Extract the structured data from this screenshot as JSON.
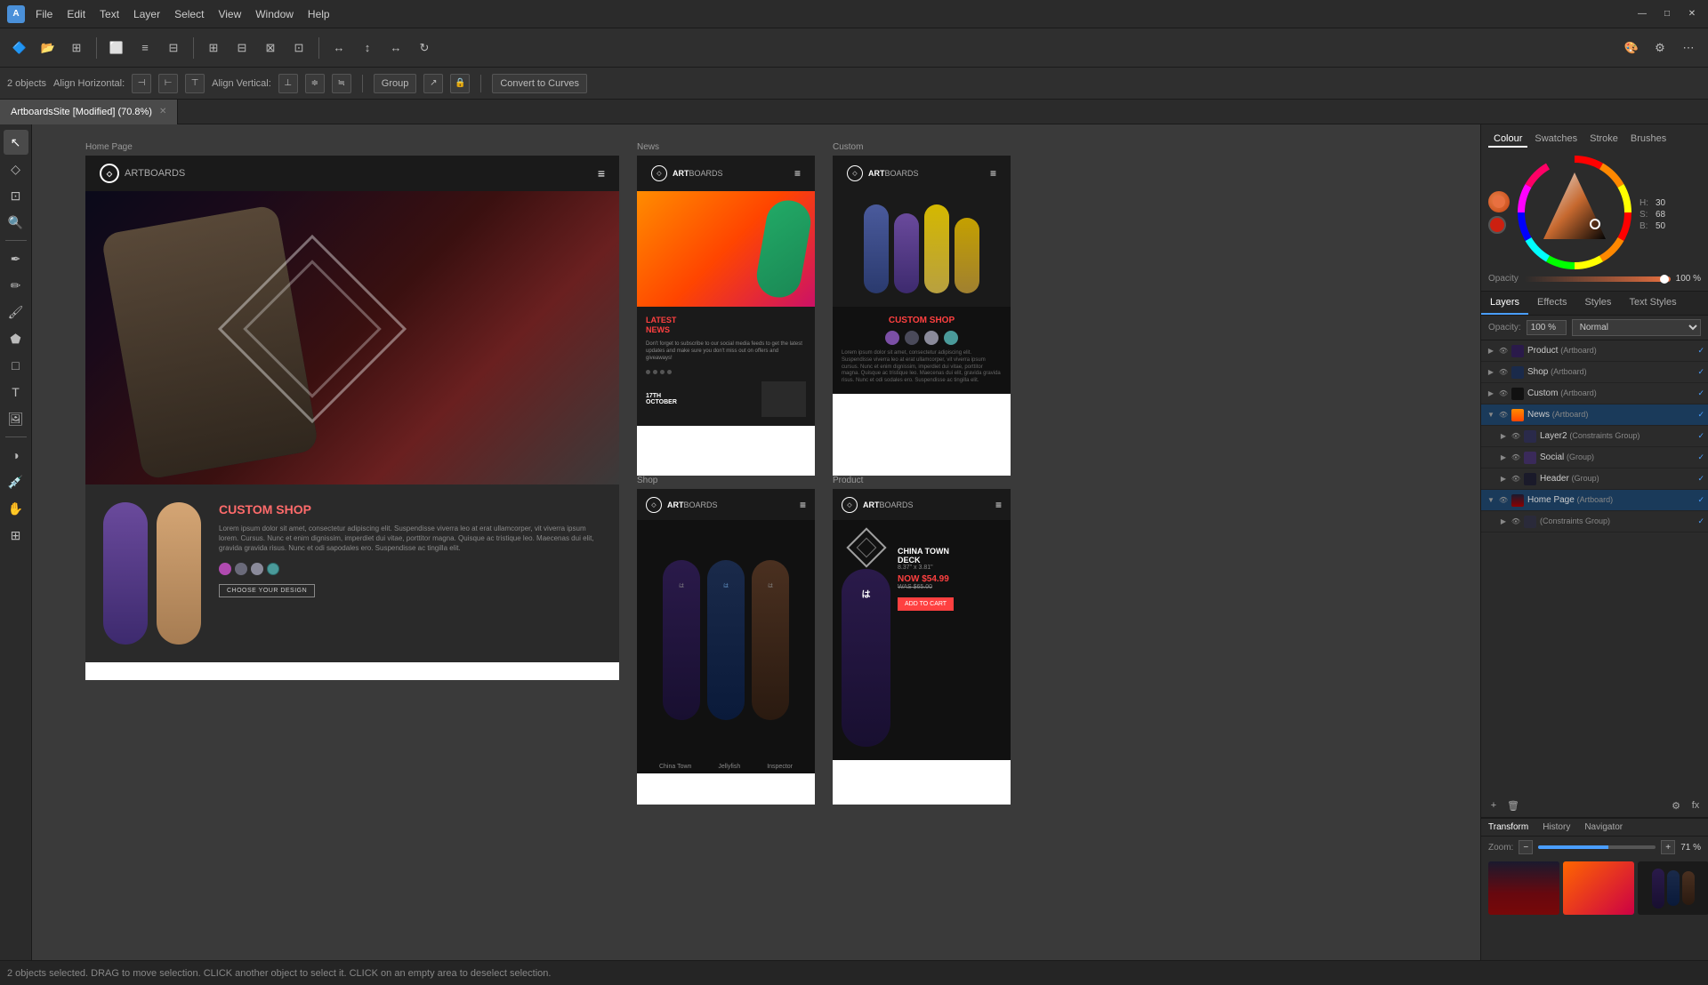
{
  "app": {
    "title": "ArtboardsSite [Modified] (70.8%)",
    "menu": [
      "File",
      "Edit",
      "Text",
      "Layer",
      "Select",
      "View",
      "Window",
      "Help"
    ]
  },
  "toolbar": {
    "items": [
      "new",
      "open",
      "save",
      "export",
      "grid",
      "grid2",
      "grid3",
      "transform",
      "transform2",
      "transform3",
      "transform4",
      "align",
      "align2",
      "align3",
      "align4",
      "align5",
      "snap",
      "snap2",
      "flip",
      "flip2",
      "rotate",
      "more"
    ]
  },
  "options": {
    "objects_selected": "2 objects",
    "align_horizontal": "Align Horizontal:",
    "align_vertical": "Align Vertical:",
    "group_label": "Group",
    "convert_label": "Convert to Curves"
  },
  "artboards": {
    "home_page": {
      "label": "Home Page",
      "hero_overlay": "ARTBOARDS",
      "custom_shop_title": "CUSTOM SHOP",
      "shop_desc": "Lorem ipsum dolor sit amet, consectetur adipiscing elit. Suspendisse viverra leo at erat ullamcorper, vit viverra ipsum lorem. Cursus. Nunc et enim dignissim, imperdiet dui vitae, porttitor magna. Quisque ac tristique leo. Maecenas dui elit, gravida gravida risus. Nunc et odi sapodales ero. Suspendisse ac tingilla elit.",
      "choose_btn": "CHOOSE YOUR DESIGN",
      "logo_text": "ART",
      "logo_subtext": "BOARDS"
    },
    "news": {
      "label": "News",
      "logo_text": "ART",
      "logo_subtext": "BOARDS",
      "section_title": "LATEST\nNEWS",
      "news_text": "Don't forget to subscribe to our social media feeds to get the latest updates and make sure you don't miss out on offers and giveaways!",
      "date": "17TH\nOCTOBER"
    },
    "custom": {
      "label": "Custom",
      "logo_text": "ART",
      "logo_subtext": "BOARDS",
      "shop_title": "CUSTOM SHOP",
      "lorem_text": "Lorem ipsum dolor sit amet, consectetur adipiscing elit. Suspendisse viverra leo at erat ullamcorper, vit viverra ipsum cursus. Nunc et enim dignissim, imperdiet dui vitae, porttitor magna. Quisque ac tristique leo. Maecenas dui elit, gravida gravida risus. Nunc et odi sodales ero. Suspendisse ac tingilla elit."
    },
    "shop": {
      "label": "Shop",
      "logo_text": "ART",
      "logo_subtext": "BOARDS"
    },
    "product": {
      "label": "Product",
      "logo_text": "ART",
      "logo_subtext": "BOARDS",
      "deck_name": "CHINA TOWN\nDECK",
      "dimensions": "8.37\" x 3.81\"",
      "price_now": "NOW $54.99",
      "price_was": "WAS $65.00"
    }
  },
  "right_panel": {
    "tabs": [
      "Colour",
      "Swatches",
      "Stroke",
      "Brushes"
    ],
    "active_tab": "Colour",
    "hsb": {
      "h": "30",
      "s": "68",
      "b": "50"
    },
    "opacity_label": "Opacity",
    "opacity_value": "100 %"
  },
  "layers_panel": {
    "tabs": [
      "Layers",
      "Effects",
      "Styles",
      "Text Styles"
    ],
    "active_tab": "Layers",
    "blend_mode": "Normal",
    "opacity": "100 %",
    "items": [
      {
        "name": "Product",
        "type": "Artboard",
        "indent": 0,
        "expanded": false,
        "visible": true,
        "locked": false
      },
      {
        "name": "Shop",
        "type": "Artboard",
        "indent": 0,
        "expanded": false,
        "visible": true,
        "locked": false
      },
      {
        "name": "Custom",
        "type": "Artboard",
        "indent": 0,
        "expanded": false,
        "visible": true,
        "locked": false
      },
      {
        "name": "News",
        "type": "Artboard",
        "indent": 0,
        "expanded": true,
        "visible": true,
        "locked": false
      },
      {
        "name": "Layer2",
        "type": "Constraints Group",
        "indent": 1,
        "expanded": false,
        "visible": true,
        "locked": false
      },
      {
        "name": "Social",
        "type": "Group",
        "indent": 1,
        "expanded": false,
        "visible": true,
        "locked": false
      },
      {
        "name": "Header",
        "type": "Group",
        "indent": 1,
        "expanded": false,
        "visible": true,
        "locked": false
      },
      {
        "name": "Home Page",
        "type": "Artboard",
        "indent": 0,
        "expanded": true,
        "visible": true,
        "locked": false
      },
      {
        "name": "(Constraints Group)",
        "type": "",
        "indent": 1,
        "expanded": false,
        "visible": true,
        "locked": false
      }
    ]
  },
  "bottom_panel": {
    "tabs": [
      "Transform",
      "History",
      "Navigator"
    ],
    "active_tab": "Transform",
    "zoom_label": "Zoom:",
    "zoom_value": "71 %"
  },
  "status_bar": {
    "text": "2 objects selected. DRAG to move selection. CLICK another object to select it. CLICK on an empty area to deselect selection."
  }
}
